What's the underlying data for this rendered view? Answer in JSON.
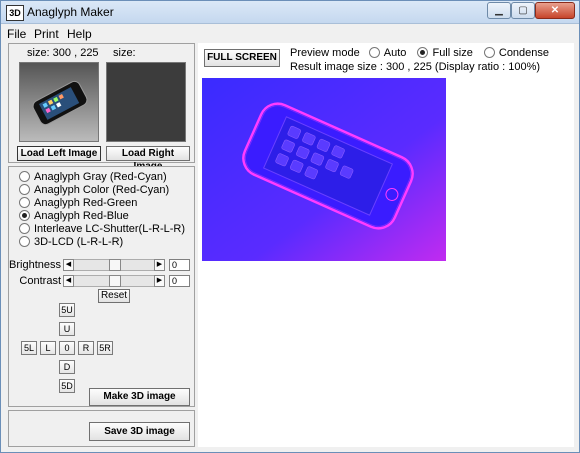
{
  "window": {
    "icon_text": "3D",
    "title": "Anaglyph Maker",
    "controls": {
      "minimize": "▁",
      "maximize": "▢",
      "close": "✕"
    }
  },
  "menu": [
    "File",
    "Print",
    "Help"
  ],
  "left_panel": {
    "left_size_label": "size: 300 , 225",
    "right_size_label": "size:",
    "load_left_button": "Load Left Image",
    "load_right_button": "Load Right Image",
    "modes": [
      {
        "label": "Anaglyph Gray (Red-Cyan)",
        "selected": false
      },
      {
        "label": "Anaglyph Color (Red-Cyan)",
        "selected": false
      },
      {
        "label": "Anaglyph Red-Green",
        "selected": false
      },
      {
        "label": "Anaglyph Red-Blue",
        "selected": true
      },
      {
        "label": "Interleave LC-Shutter(L-R-L-R)",
        "selected": false
      },
      {
        "label": "3D-LCD (L-R-L-R)",
        "selected": false
      }
    ],
    "brightness_label": "Brightness",
    "brightness_value": "0",
    "contrast_label": "Contrast",
    "contrast_value": "0",
    "reset_button": "Reset",
    "direction_buttons": {
      "up5": "5U",
      "up": "U",
      "left5": "5L",
      "left": "L",
      "center": "0",
      "right": "R",
      "right5": "5R",
      "down": "D",
      "down5": "5D"
    },
    "make_button": "Make 3D image",
    "save_button": "Save 3D image"
  },
  "right_panel": {
    "full_screen_button": "FULL SCREEN",
    "preview_mode_label": "Preview mode",
    "preview_modes": [
      {
        "label": "Auto",
        "selected": false
      },
      {
        "label": "Full size",
        "selected": true
      },
      {
        "label": "Condense",
        "selected": false
      }
    ],
    "result_label": "Result image size :  300 , 225  (Display ratio : 100%)"
  },
  "colors": {
    "preview_bg_start": "#3a2bff",
    "preview_bg_end": "#c12bf0",
    "phone_edge": "#ff3cff"
  }
}
